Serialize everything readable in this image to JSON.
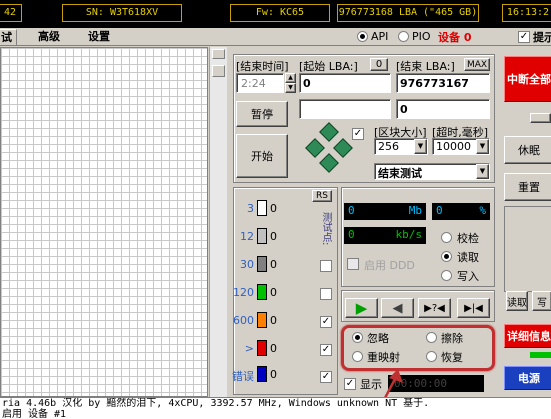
{
  "infobar": {
    "model_fragment": "42",
    "serial": "SN: W3T618XV",
    "firmware": "Fw: KC65",
    "capacity": "976773168 LBA (\"465 GB)",
    "clock": "16:13:2"
  },
  "tabs": [
    {
      "label": "试"
    },
    {
      "label": "高级"
    },
    {
      "label": "设置"
    }
  ],
  "mode": {
    "api_label": "API",
    "pio_label": "PIO",
    "device_label": "设备 0",
    "prompt_label": "提示"
  },
  "test": {
    "elapsed_label": "[结束时间]",
    "elapsed_value": "2:24",
    "start_lba_label": "[起始 LBA:]",
    "start_lba_button": "0",
    "start_lba_value": "0",
    "end_lba_label": "[结束 LBA:]",
    "end_lba_button": "MAX",
    "end_lba_value": "976773167",
    "end_lba_value2": "0",
    "pause_label": "暂停",
    "start_label": "开始",
    "block_size_label": "[区块大小]",
    "block_size_value": "256",
    "timeout_label": "[超时,毫秒]",
    "timeout_value": "10000",
    "end_test_value": "结束测试"
  },
  "stats": {
    "rs_label": "RS",
    "rows": [
      {
        "ms": "3",
        "count": "0",
        "color": "#ffffff"
      },
      {
        "ms": "12",
        "count": "0",
        "color": "#c0c0c0"
      },
      {
        "ms": "30",
        "count": "0",
        "color": "#808080"
      },
      {
        "ms": "120",
        "count": "0",
        "color": "#00c000"
      },
      {
        "ms": "600",
        "count": "0",
        "color": "#ff8000"
      },
      {
        "ms": ">",
        "count": "0",
        "color": "#e00000"
      },
      {
        "ms": "错误",
        "count": "0",
        "color": "#0000c0"
      }
    ],
    "vertical_label": "测试点:"
  },
  "readout": {
    "mb_value": "0",
    "mb_unit": "Mb",
    "pct_value": "0",
    "pct_unit": "%",
    "kbs_value": "0",
    "kbs_unit": "kb/s",
    "ddd_label": "启用 DDD",
    "verify_label": "校检",
    "read_label": "读取",
    "write_label": "写入"
  },
  "transport": {
    "play": "▶",
    "back": "◀",
    "skip": "▶?◀",
    "end": "▶|◀"
  },
  "actions": {
    "ignore_label": "忽略",
    "erase_label": "擦除",
    "remap_label": "重映射",
    "restore_label": "恢复",
    "grid_label": "显示",
    "grid_value": "00:00:00"
  },
  "right": {
    "stop_all": "中断全部",
    "sleep": "休眠",
    "reset": "重置",
    "read": "读取",
    "write": "写",
    "details": "详细信息",
    "power": "电源"
  },
  "status": {
    "line1": "ria 4.46b 汉化 by 黯然的泪下, 4xCPU, 3392.57 MHz, Windows unknown NT 基于.",
    "line2": "启用 设备 #1"
  },
  "colors": {
    "accent_red": "#e00000",
    "info_text": "#e8d000",
    "annotation": "#c03030"
  }
}
